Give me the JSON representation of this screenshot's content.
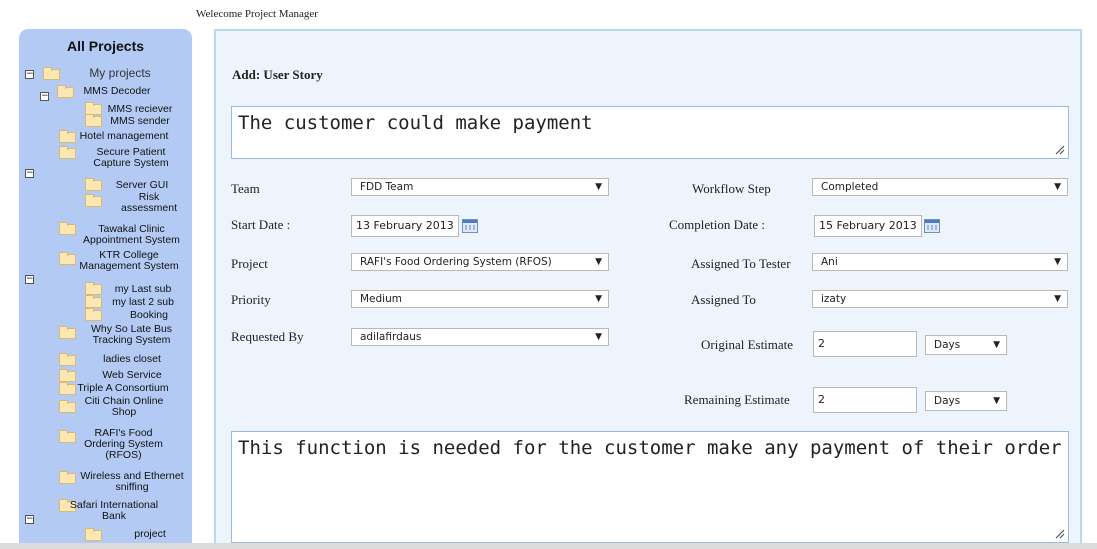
{
  "welcome": "Welecome Project Manager",
  "sidebar": {
    "title": "All Projects",
    "root": "My projects",
    "items": [
      "MMS Decoder",
      "MMS reciever",
      "MMS sender",
      "Hotel management",
      "Secure Patient Capture System",
      "Server GUI",
      "Risk assessment",
      "Tawakal Clinic Appointment System",
      "KTR College Management System",
      "my Last sub",
      "my last 2 sub",
      "Booking",
      "Why So Late Bus Tracking System",
      "ladies closet",
      "Web Service",
      "Triple A Consortium",
      "Citi Chain Online Shop",
      "RAFI's Food Ordering System (RFOS)",
      "Wireless and Ethernet sniffing",
      "Safari International Bank",
      "project"
    ]
  },
  "form": {
    "title": "Add: User Story",
    "story": "The customer could make payment",
    "description": "This function is needed for the customer make any payment of their order",
    "team_label": "Team",
    "team_value": "FDD Team",
    "start_label": "Start Date :",
    "start_value": "13 February 2013",
    "project_label": "Project",
    "project_value": "RAFI's Food Ordering System (RFOS)",
    "priority_label": "Priority",
    "priority_value": "Medium",
    "requested_label": "Requested By",
    "requested_value": "adilafirdaus",
    "workflow_label": "Workflow Step",
    "workflow_value": "Completed",
    "completion_label": "Completion Date :",
    "completion_value": "15 February 2013",
    "tester_label": "Assigned To Tester",
    "tester_value": "Ani",
    "assigned_label": "Assigned To",
    "assigned_value": "izaty",
    "original_label": "Original Estimate",
    "original_value": "2",
    "original_unit": "Days",
    "remaining_label": "Remaining Estimate",
    "remaining_value": "2",
    "remaining_unit": "Days",
    "dropdown_arrow": "▼",
    "toggle_symbol": "−"
  }
}
